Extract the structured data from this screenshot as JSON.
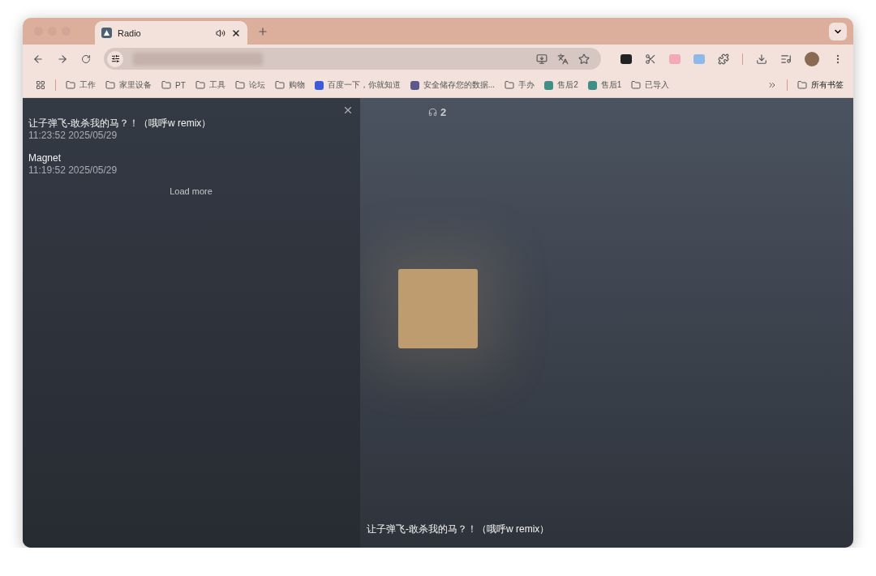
{
  "tabs": [
    {
      "title": "Radio",
      "selected": true,
      "audible": true
    }
  ],
  "bookmarks": [
    {
      "kind": "folder",
      "label": "工作"
    },
    {
      "kind": "folder",
      "label": "家里设备"
    },
    {
      "kind": "folder",
      "label": "PT"
    },
    {
      "kind": "folder",
      "label": "工具"
    },
    {
      "kind": "folder",
      "label": "论坛"
    },
    {
      "kind": "folder",
      "label": "购物"
    },
    {
      "kind": "site",
      "label": "百度一下，你就知道",
      "color": "#3b5bdb"
    },
    {
      "kind": "site",
      "label": "安全储存您的数据...",
      "color": "#5a5a8a"
    },
    {
      "kind": "folder",
      "label": "手办"
    },
    {
      "kind": "site",
      "label": "售后2",
      "color": "#3f8f86"
    },
    {
      "kind": "site",
      "label": "售后1",
      "color": "#3f8f86"
    },
    {
      "kind": "folder",
      "label": "已导入"
    }
  ],
  "all_bookmarks": "所有书签",
  "history": [
    {
      "title": "让子弹飞-敢杀我的马？！（哦呼w remix）",
      "time": "11:23:52 2025/05/29"
    },
    {
      "title": "Magnet",
      "time": "11:19:52 2025/05/29"
    }
  ],
  "load_more": "Load more",
  "listeners": "2",
  "now_playing": "让子弹飞-敢杀我的马？！（哦呼w remix）"
}
